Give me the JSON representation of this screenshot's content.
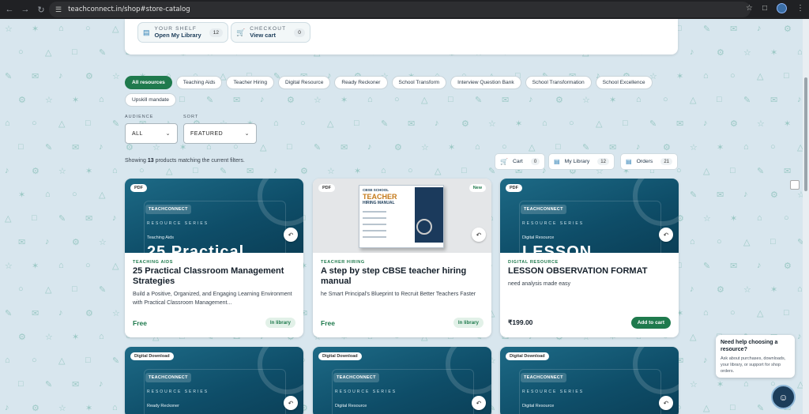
{
  "browser": {
    "url": "teachconnect.in/shop#store-catalog",
    "back_icon": "arrow-left",
    "forward_icon": "arrow-right",
    "reload_icon": "reload"
  },
  "top_actions": {
    "shelf": {
      "eyebrow": "YOUR SHELF",
      "label": "Open My Library",
      "count": "12"
    },
    "checkout": {
      "eyebrow": "CHECKOUT",
      "label": "View cart",
      "count": "0"
    }
  },
  "filters": {
    "chips": [
      "All resources",
      "Teaching Aids",
      "Teacher Hiring",
      "Digital Resource",
      "Ready Reckoner",
      "School Transform",
      "Interview Question Bank",
      "School Transformation",
      "School Excellence",
      "Upskill mandate"
    ],
    "active": "All resources",
    "audience_label": "AUDIENCE",
    "audience_value": "ALL",
    "sort_label": "SORT",
    "sort_value": "FEATURED"
  },
  "results": {
    "prefix": "Showing",
    "count": "13",
    "suffix": "products matching the current filters."
  },
  "summary": {
    "cart": {
      "label": "Cart",
      "count": "0"
    },
    "library": {
      "label": "My Library",
      "count": "12"
    },
    "orders": {
      "label": "Orders",
      "count": "21"
    }
  },
  "cover_common": {
    "brand": "TEACHCONNECT",
    "series": "RESOURCE SERIES"
  },
  "products": [
    {
      "badge": "PDF",
      "cover_category": "Teaching Aids",
      "cover_big": "25 Practical",
      "kicker": "TEACHING AIDS",
      "title": "25 Practical Classroom Management Strategies",
      "desc": "Build a Positive, Organized, and Engaging Learning Environment with Practical Classroom Management...",
      "price": "Free",
      "action": "In library"
    },
    {
      "badge": "PDF",
      "badge_right": "New",
      "cover_book": {
        "line1": "CBSE SCHOOL",
        "line2": "TEACHER",
        "line3": "HIRING MANUAL"
      },
      "kicker": "TEACHER HIRING",
      "title": "A step by step CBSE teacher hiring manual",
      "desc": "he Smart Principal's Blueprint to Recruit Better Teachers Faster",
      "price": "Free",
      "action": "In library"
    },
    {
      "badge": "PDF",
      "cover_category": "Digital Resource",
      "cover_big": "LESSON",
      "kicker": "DIGITAL RESOURCE",
      "title": "LESSON OBSERVATION FORMAT",
      "desc": "need analysis made easy",
      "price": "₹199.00",
      "action": "Add to cart"
    }
  ],
  "products_row2": [
    {
      "badge": "Digital Download",
      "cover_category": "Ready Reckoner"
    },
    {
      "badge": "Digital Download",
      "cover_category": "Digital Resource"
    },
    {
      "badge": "Digital Download",
      "cover_category": "Digital Resource"
    }
  ],
  "help": {
    "title": "Need help choosing a resource?",
    "text": "Ask about purchases, downloads, your library, or support for shop orders."
  },
  "colors": {
    "accent": "#1f7a4d",
    "cover": "#0e4d68",
    "background": "#d8e6ee"
  }
}
